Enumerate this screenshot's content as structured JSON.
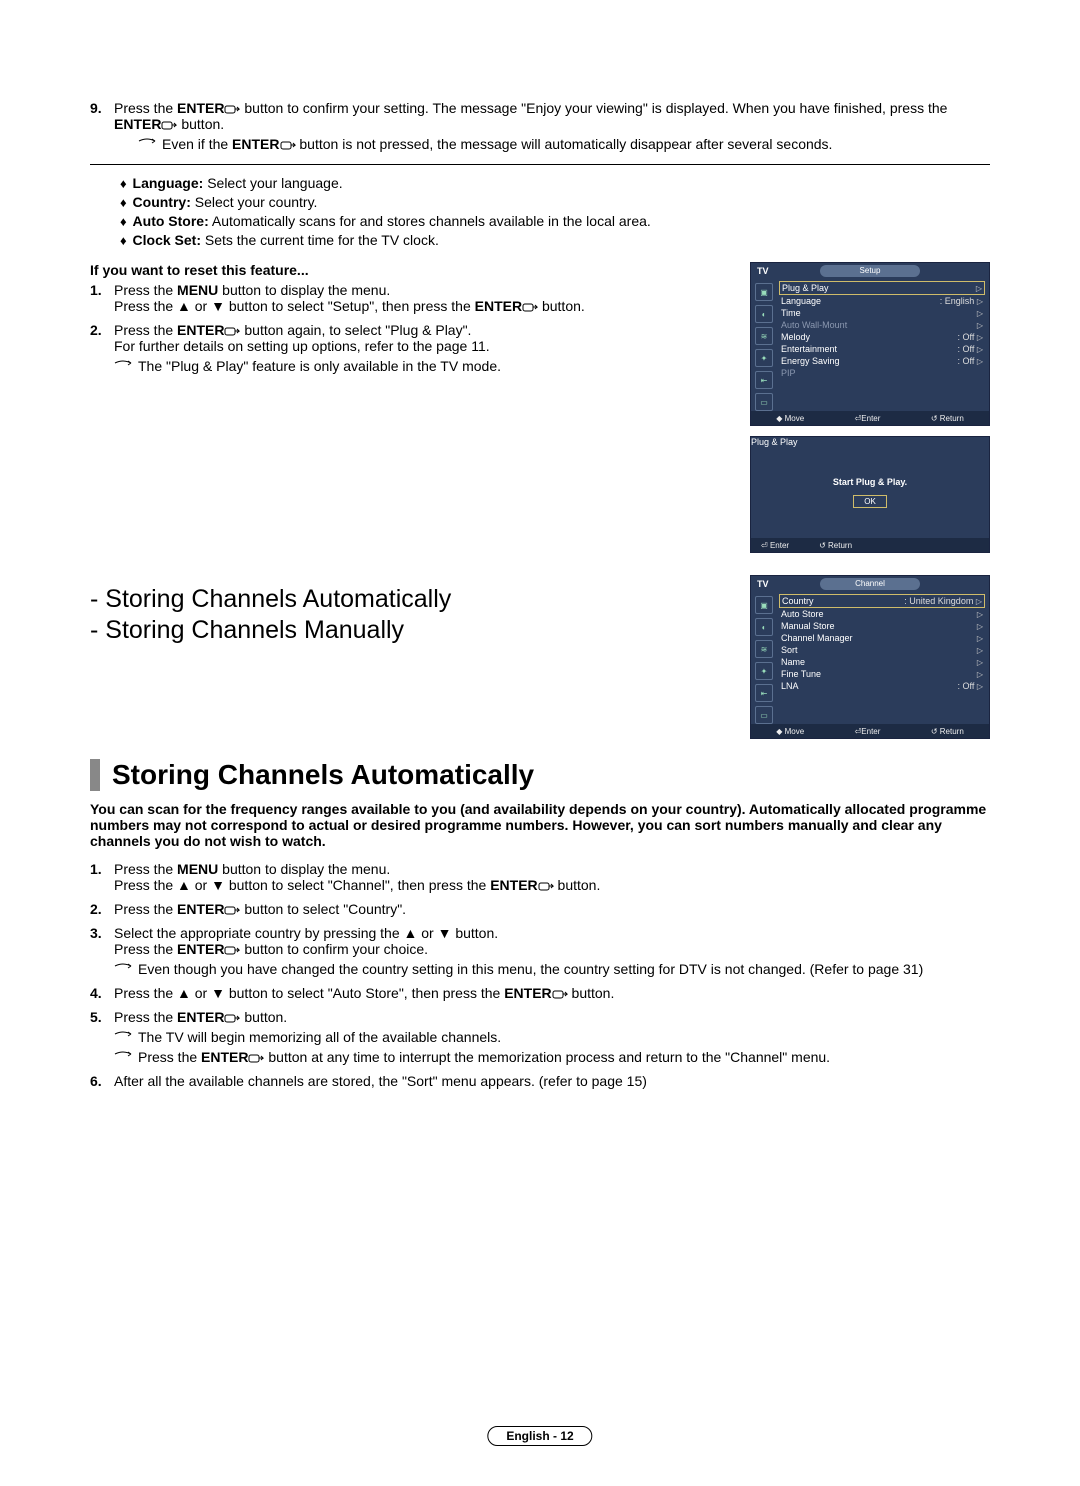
{
  "step9": {
    "num": "9.",
    "line1_a": "Press the ",
    "line1_b": "ENTER",
    "line1_c": " button to confirm your setting. The message \"Enjoy your viewing\" is displayed. When you have finished, press  the ",
    "line1_d": "ENTER",
    "line1_e": "  button.",
    "note_a": "Even if the ",
    "note_b": "ENTER",
    "note_c": " button is not pressed, the message will automatically disappear after several seconds."
  },
  "bullets": {
    "lang_b": "Language:",
    "lang_t": " Select your language.",
    "country_b": "Country:",
    "country_t": " Select your country.",
    "auto_b": "Auto Store:",
    "auto_t": " Automatically scans for and stores channels available in the local area.",
    "clock_b": "Clock Set:",
    "clock_t": " Sets the current time for the TV clock."
  },
  "reset": {
    "title": "If you want to reset this feature...",
    "s1num": "1.",
    "s1_a": "Press the ",
    "s1_b": "MENU",
    "s1_c": " button to display the menu.\nPress the ▲ or ▼ button to select \"Setup\", then press the ",
    "s1_d": "ENTER",
    "s1_e": " button.",
    "s2num": "2.",
    "s2_a": "Press the ",
    "s2_b": "ENTER",
    "s2_c": " button again, to select \"Plug & Play\".\nFor further details on setting up options, refer to the page 11.",
    "s2_note": "The \"Plug & Play\" feature is only available in the TV mode."
  },
  "titles": {
    "t1": "- Storing Channels Automatically",
    "t2": "- Storing Channels Manually"
  },
  "heading": "Storing Channels Automatically",
  "intro": "You can scan for the frequency ranges available to you (and availability depends on your country). Automatically allocated programme numbers may not correspond to actual or desired programme numbers. However, you can sort numbers manually and clear any channels you do not wish to watch.",
  "steps": {
    "s1num": "1.",
    "s1_a": "Press the ",
    "s1_b": "MENU",
    "s1_c": " button to display the menu.\nPress the ▲ or ▼ button to select \"Channel\", then press the ",
    "s1_d": "ENTER",
    "s1_e": " button.",
    "s2num": "2.",
    "s2_a": "Press the ",
    "s2_b": "ENTER",
    "s2_c": " button to select \"Country\".",
    "s3num": "3.",
    "s3_a": "Select the appropriate country by pressing the ▲ or ▼ button.\nPress the ",
    "s3_b": "ENTER",
    "s3_c": " button to confirm your choice.",
    "s3_note": "Even though you have changed the country setting in this menu, the country setting for DTV is not changed. (Refer to page 31)",
    "s4num": "4.",
    "s4_a": "Press the ▲ or ▼ button to select \"Auto Store\", then press the ",
    "s4_b": "ENTER",
    "s4_c": " button.",
    "s5num": "5.",
    "s5_a": "Press the ",
    "s5_b": "ENTER",
    "s5_c": " button.",
    "s5_note1": "The TV will begin memorizing all of the available channels.",
    "s5_note2_a": "Press the ",
    "s5_note2_b": "ENTER",
    "s5_note2_c": " button at any time to interrupt the memorization process and return to the \"Channel\" menu.",
    "s6num": "6.",
    "s6": "After all the available channels are stored, the \"Sort\" menu appears. (refer to page 15)"
  },
  "footer": "English - 12",
  "osd1": {
    "tv": "TV",
    "title": "Setup",
    "r1": "Plug & Play",
    "r2_l": "Language",
    "r2_v": ": English",
    "r3": "Time",
    "r4": "Auto Wall-Mount",
    "r5_l": "Melody",
    "r5_v": ": Off",
    "r6_l": "Entertainment",
    "r6_v": ": Off",
    "r7_l": "Energy Saving",
    "r7_v": ": Off",
    "r8": "PIP",
    "f_move": "Move",
    "f_enter": "Enter",
    "f_return": "Return"
  },
  "osd2": {
    "title": "Plug & Play",
    "msg": "Start Plug & Play.",
    "ok": "OK",
    "f_enter": "Enter",
    "f_return": "Return"
  },
  "osd3": {
    "tv": "TV",
    "title": "Channel",
    "r1_l": "Country",
    "r1_v": ": United Kingdom",
    "r2": "Auto Store",
    "r3": "Manual Store",
    "r4": "Channel Manager",
    "r5": "Sort",
    "r6": "Name",
    "r7": "Fine Tune",
    "r8_l": "LNA",
    "r8_v": ": Off",
    "f_move": "Move",
    "f_enter": "Enter",
    "f_return": "Return"
  }
}
